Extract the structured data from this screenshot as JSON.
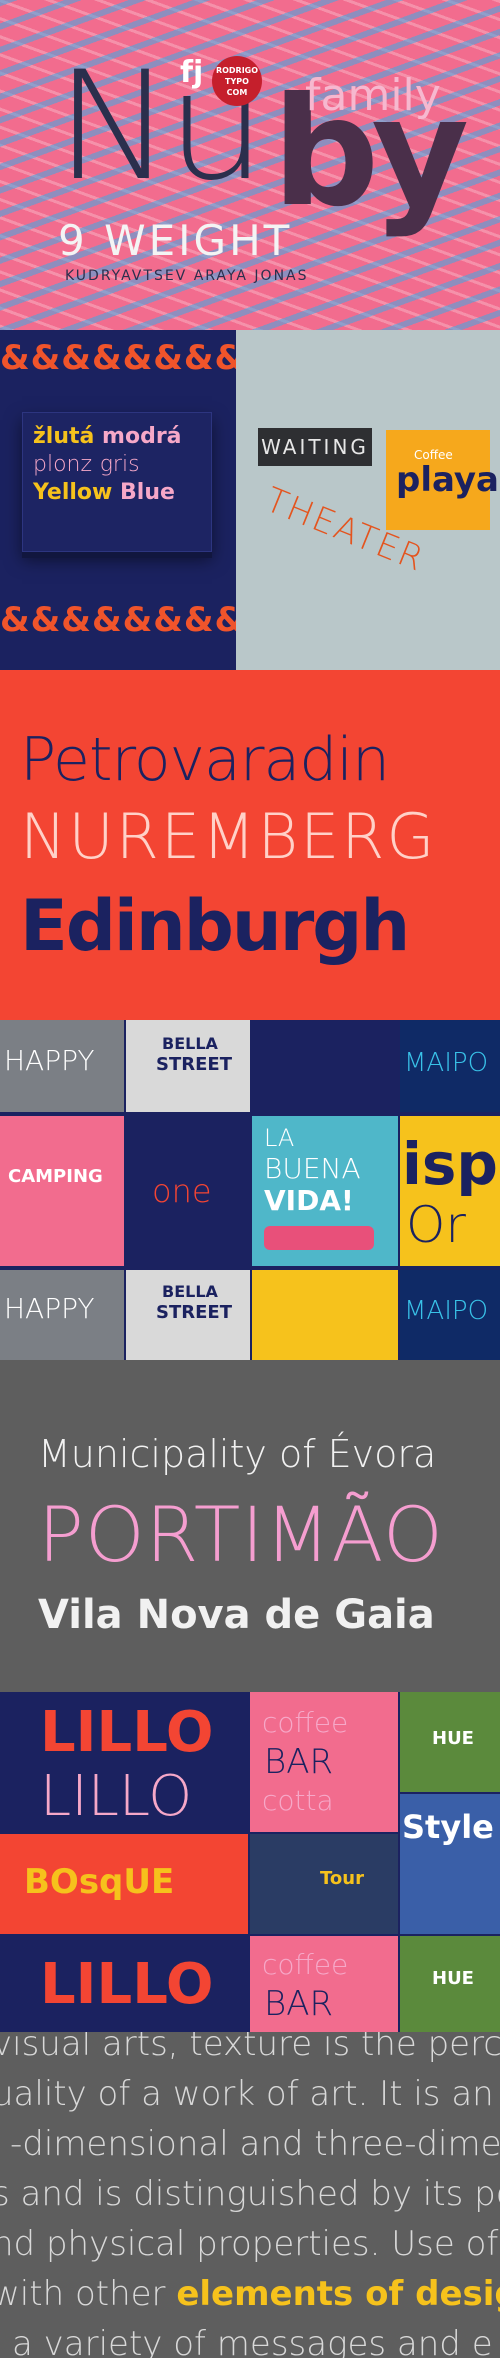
{
  "hero": {
    "fj": "fj",
    "badge_line1": "RODRIGO",
    "badge_line2": "TYPO",
    "badge_line3": "COM",
    "title_left": "Nu",
    "title_right": "by",
    "family": "family",
    "weights": "9 WEIGHT",
    "authors": "KUDRYAVTSEV  ARAYA  JONAS"
  },
  "books": {
    "ampersands": "&&&&&&&&&&",
    "words_line1a": "žlutá",
    "words_line1b": "modrá",
    "words_line2a": "plonz",
    "words_line2b": "gris",
    "words_line3a": "Yellow",
    "words_line3b": "Blue",
    "waiting": "WAITING",
    "coffee_small": "Coffee",
    "coffee_big": "playa",
    "theater": "THEATER"
  },
  "red_cities": {
    "line1": "Petrovaradin",
    "line2": "NUREMBERG",
    "line3": "Edinburgh"
  },
  "collage1": {
    "happy": "HAPPY",
    "bella": "BELLA",
    "street": "STREET",
    "maipo": "MAIPO",
    "camping": "CAMPING",
    "one": "one",
    "la": "LA",
    "buena": "BUENA",
    "vida": "VIDA!",
    "isp": "isp",
    "or": "Or"
  },
  "gray_cities": {
    "line1": "Municipality of Évora",
    "line2": "PORTIMÃO",
    "line3": "Vila Nova de Gaia"
  },
  "collage2": {
    "lillo": "LILLO",
    "coffee": "coffee",
    "bar": "BAR",
    "cotta": "cotta",
    "hue": "HUE",
    "bosque": "BOsqUE",
    "style": "Style",
    "tour": "Tour"
  },
  "paragraph": {
    "line1": "visual arts, texture is the perceiv",
    "line2": "uality of a work of art. It is an ele",
    "line3": "-dimensional and three-dimen",
    "line4": "s and is distinguished by its pe",
    "line5": "nd physical properties. Use of",
    "line6a": "with other ",
    "line6b": "elements of design",
    "line6c": ",",
    "line7": "a variety of messages and e"
  },
  "colors": {
    "navy": "#1b2260",
    "pink": "#f26c8e",
    "red": "#f34533",
    "gray": "#5e5e5e",
    "yellow": "#f6c21c"
  }
}
